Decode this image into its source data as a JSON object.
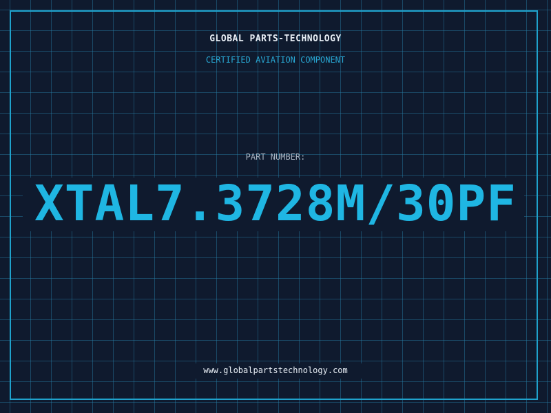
{
  "header": {
    "company_name": "GLOBAL PARTS-TECHNOLOGY",
    "tagline": "CERTIFIED AVIATION COMPONENT"
  },
  "part": {
    "label": "PART NUMBER:",
    "number": "XTAL7.3728M/30PF"
  },
  "footer": {
    "website": "www.globalpartstechnology.com"
  },
  "colors": {
    "background": "#0f1a2e",
    "grid": "#2882aa",
    "accent": "#1fb6e3",
    "text": "#e8eef5",
    "muted": "#a8b4c2"
  }
}
